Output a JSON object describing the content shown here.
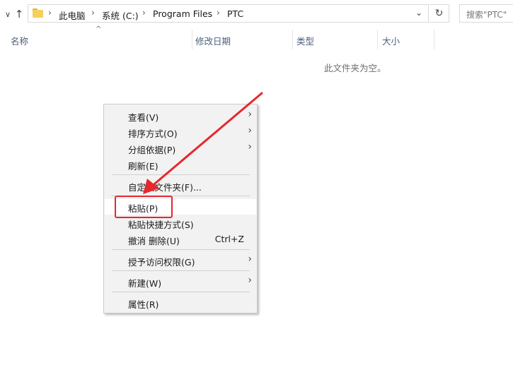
{
  "nav": {
    "back": "∨",
    "up": "↑"
  },
  "address": {
    "sep": "›",
    "crumbs": [
      "此电脑",
      "系统 (C:)",
      "Program Files",
      "PTC"
    ],
    "dropdown": "⌄",
    "refresh": "↻"
  },
  "search": {
    "placeholder": "搜索\"PTC\""
  },
  "columns": {
    "sort": "^",
    "name": "名称",
    "modified": "修改日期",
    "type": "类型",
    "size": "大小"
  },
  "empty_message": "此文件夹为空。",
  "menu": {
    "chev": "›",
    "items": [
      {
        "label": "查看(V)"
      },
      {
        "label": "排序方式(O)"
      },
      {
        "label": "分组依据(P)"
      },
      {
        "label": "刷新(E)"
      },
      {
        "label": "自定义文件夹(F)..."
      },
      {
        "label": "粘贴(P)"
      },
      {
        "label": "粘贴快捷方式(S)"
      },
      {
        "label": "撤消 删除(U)",
        "shortcut": "Ctrl+Z"
      },
      {
        "label": "授予访问权限(G)"
      },
      {
        "label": "新建(W)"
      },
      {
        "label": "属性(R)"
      }
    ]
  },
  "colors": {
    "highlight": "#e8262d",
    "menu_bg": "#f2f2f2",
    "folder": "#f6cf5c",
    "header_text": "#4c607a"
  },
  "icons": [
    "folder-icon",
    "chevron-down-icon",
    "up-arrow-icon",
    "refresh-icon",
    "chevron-right-icon",
    "sort-up-icon"
  ]
}
